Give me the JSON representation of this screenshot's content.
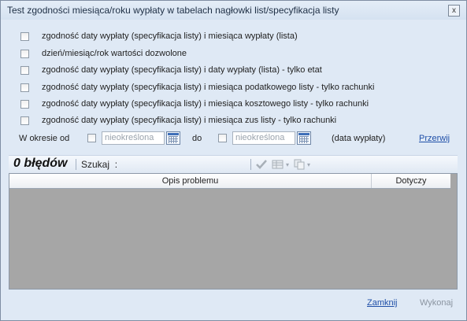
{
  "window": {
    "title": "Test zgodności miesiąca/roku wypłaty w tabelach nagłowki list/specyfikacja listy",
    "close_glyph": "x"
  },
  "checks": [
    {
      "label": "zgodność daty wypłaty (specyfikacja listy) i miesiąca wypłaty (lista)",
      "checked": false
    },
    {
      "label": "dzień/miesiąc/rok wartości dozwolone",
      "checked": false
    },
    {
      "label": "zgodność daty wypłaty (specyfikacja listy) i daty wypłaty (lista) - tylko etat",
      "checked": false
    },
    {
      "label": "zgodność daty wypłaty (specyfikacja listy) i miesiąca podatkowego listy - tylko rachunki",
      "checked": false
    },
    {
      "label": "zgodność daty wypłaty (specyfikacja listy) i miesiąca kosztowego listy - tylko rachunki",
      "checked": false
    },
    {
      "label": "zgodność daty wypłaty (specyfikacja listy) i miesiąca zus listy - tylko rachunki",
      "checked": false
    }
  ],
  "period": {
    "label": "W okresie od",
    "from_value": "nieokreślona",
    "to_label": "do",
    "to_value": "nieokreślona",
    "suffix": "(data wypłaty)",
    "interrupt_link": "Przerwij"
  },
  "toolbar": {
    "error_count": "0 błędów",
    "search_label": "Szukaj",
    "search_colon": ":",
    "search_value": "",
    "icons": [
      "checkmark-icon",
      "table-icon",
      "copy-icon"
    ]
  },
  "grid": {
    "columns": [
      "Opis problemu",
      "Dotyczy"
    ],
    "rows": []
  },
  "footer": {
    "close_link": "Zamknij",
    "run_button": "Wykonaj"
  }
}
